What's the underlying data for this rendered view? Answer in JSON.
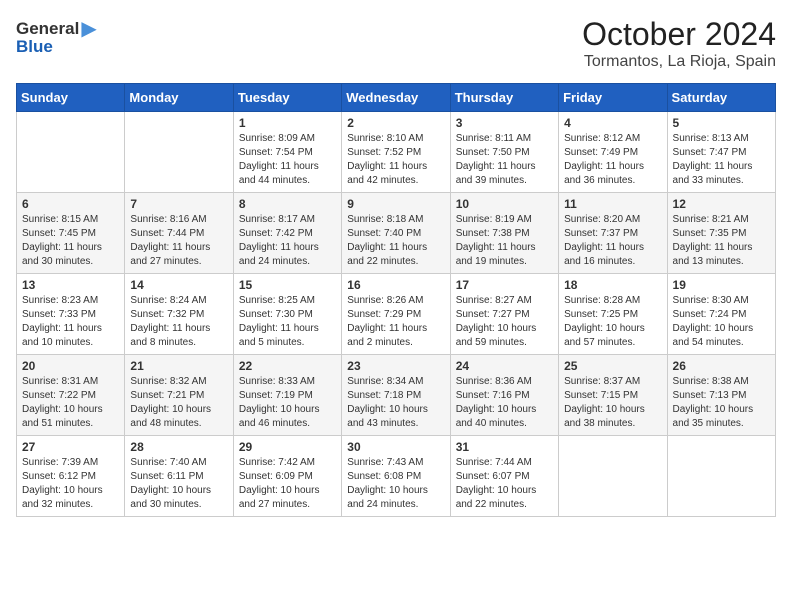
{
  "header": {
    "logo_general": "General",
    "logo_blue": "Blue",
    "month": "October 2024",
    "location": "Tormantos, La Rioja, Spain"
  },
  "weekdays": [
    "Sunday",
    "Monday",
    "Tuesday",
    "Wednesday",
    "Thursday",
    "Friday",
    "Saturday"
  ],
  "weeks": [
    [
      {
        "day": "",
        "sunrise": "",
        "sunset": "",
        "daylight": ""
      },
      {
        "day": "",
        "sunrise": "",
        "sunset": "",
        "daylight": ""
      },
      {
        "day": "1",
        "sunrise": "Sunrise: 8:09 AM",
        "sunset": "Sunset: 7:54 PM",
        "daylight": "Daylight: 11 hours and 44 minutes."
      },
      {
        "day": "2",
        "sunrise": "Sunrise: 8:10 AM",
        "sunset": "Sunset: 7:52 PM",
        "daylight": "Daylight: 11 hours and 42 minutes."
      },
      {
        "day": "3",
        "sunrise": "Sunrise: 8:11 AM",
        "sunset": "Sunset: 7:50 PM",
        "daylight": "Daylight: 11 hours and 39 minutes."
      },
      {
        "day": "4",
        "sunrise": "Sunrise: 8:12 AM",
        "sunset": "Sunset: 7:49 PM",
        "daylight": "Daylight: 11 hours and 36 minutes."
      },
      {
        "day": "5",
        "sunrise": "Sunrise: 8:13 AM",
        "sunset": "Sunset: 7:47 PM",
        "daylight": "Daylight: 11 hours and 33 minutes."
      }
    ],
    [
      {
        "day": "6",
        "sunrise": "Sunrise: 8:15 AM",
        "sunset": "Sunset: 7:45 PM",
        "daylight": "Daylight: 11 hours and 30 minutes."
      },
      {
        "day": "7",
        "sunrise": "Sunrise: 8:16 AM",
        "sunset": "Sunset: 7:44 PM",
        "daylight": "Daylight: 11 hours and 27 minutes."
      },
      {
        "day": "8",
        "sunrise": "Sunrise: 8:17 AM",
        "sunset": "Sunset: 7:42 PM",
        "daylight": "Daylight: 11 hours and 24 minutes."
      },
      {
        "day": "9",
        "sunrise": "Sunrise: 8:18 AM",
        "sunset": "Sunset: 7:40 PM",
        "daylight": "Daylight: 11 hours and 22 minutes."
      },
      {
        "day": "10",
        "sunrise": "Sunrise: 8:19 AM",
        "sunset": "Sunset: 7:38 PM",
        "daylight": "Daylight: 11 hours and 19 minutes."
      },
      {
        "day": "11",
        "sunrise": "Sunrise: 8:20 AM",
        "sunset": "Sunset: 7:37 PM",
        "daylight": "Daylight: 11 hours and 16 minutes."
      },
      {
        "day": "12",
        "sunrise": "Sunrise: 8:21 AM",
        "sunset": "Sunset: 7:35 PM",
        "daylight": "Daylight: 11 hours and 13 minutes."
      }
    ],
    [
      {
        "day": "13",
        "sunrise": "Sunrise: 8:23 AM",
        "sunset": "Sunset: 7:33 PM",
        "daylight": "Daylight: 11 hours and 10 minutes."
      },
      {
        "day": "14",
        "sunrise": "Sunrise: 8:24 AM",
        "sunset": "Sunset: 7:32 PM",
        "daylight": "Daylight: 11 hours and 8 minutes."
      },
      {
        "day": "15",
        "sunrise": "Sunrise: 8:25 AM",
        "sunset": "Sunset: 7:30 PM",
        "daylight": "Daylight: 11 hours and 5 minutes."
      },
      {
        "day": "16",
        "sunrise": "Sunrise: 8:26 AM",
        "sunset": "Sunset: 7:29 PM",
        "daylight": "Daylight: 11 hours and 2 minutes."
      },
      {
        "day": "17",
        "sunrise": "Sunrise: 8:27 AM",
        "sunset": "Sunset: 7:27 PM",
        "daylight": "Daylight: 10 hours and 59 minutes."
      },
      {
        "day": "18",
        "sunrise": "Sunrise: 8:28 AM",
        "sunset": "Sunset: 7:25 PM",
        "daylight": "Daylight: 10 hours and 57 minutes."
      },
      {
        "day": "19",
        "sunrise": "Sunrise: 8:30 AM",
        "sunset": "Sunset: 7:24 PM",
        "daylight": "Daylight: 10 hours and 54 minutes."
      }
    ],
    [
      {
        "day": "20",
        "sunrise": "Sunrise: 8:31 AM",
        "sunset": "Sunset: 7:22 PM",
        "daylight": "Daylight: 10 hours and 51 minutes."
      },
      {
        "day": "21",
        "sunrise": "Sunrise: 8:32 AM",
        "sunset": "Sunset: 7:21 PM",
        "daylight": "Daylight: 10 hours and 48 minutes."
      },
      {
        "day": "22",
        "sunrise": "Sunrise: 8:33 AM",
        "sunset": "Sunset: 7:19 PM",
        "daylight": "Daylight: 10 hours and 46 minutes."
      },
      {
        "day": "23",
        "sunrise": "Sunrise: 8:34 AM",
        "sunset": "Sunset: 7:18 PM",
        "daylight": "Daylight: 10 hours and 43 minutes."
      },
      {
        "day": "24",
        "sunrise": "Sunrise: 8:36 AM",
        "sunset": "Sunset: 7:16 PM",
        "daylight": "Daylight: 10 hours and 40 minutes."
      },
      {
        "day": "25",
        "sunrise": "Sunrise: 8:37 AM",
        "sunset": "Sunset: 7:15 PM",
        "daylight": "Daylight: 10 hours and 38 minutes."
      },
      {
        "day": "26",
        "sunrise": "Sunrise: 8:38 AM",
        "sunset": "Sunset: 7:13 PM",
        "daylight": "Daylight: 10 hours and 35 minutes."
      }
    ],
    [
      {
        "day": "27",
        "sunrise": "Sunrise: 7:39 AM",
        "sunset": "Sunset: 6:12 PM",
        "daylight": "Daylight: 10 hours and 32 minutes."
      },
      {
        "day": "28",
        "sunrise": "Sunrise: 7:40 AM",
        "sunset": "Sunset: 6:11 PM",
        "daylight": "Daylight: 10 hours and 30 minutes."
      },
      {
        "day": "29",
        "sunrise": "Sunrise: 7:42 AM",
        "sunset": "Sunset: 6:09 PM",
        "daylight": "Daylight: 10 hours and 27 minutes."
      },
      {
        "day": "30",
        "sunrise": "Sunrise: 7:43 AM",
        "sunset": "Sunset: 6:08 PM",
        "daylight": "Daylight: 10 hours and 24 minutes."
      },
      {
        "day": "31",
        "sunrise": "Sunrise: 7:44 AM",
        "sunset": "Sunset: 6:07 PM",
        "daylight": "Daylight: 10 hours and 22 minutes."
      },
      {
        "day": "",
        "sunrise": "",
        "sunset": "",
        "daylight": ""
      },
      {
        "day": "",
        "sunrise": "",
        "sunset": "",
        "daylight": ""
      }
    ]
  ]
}
